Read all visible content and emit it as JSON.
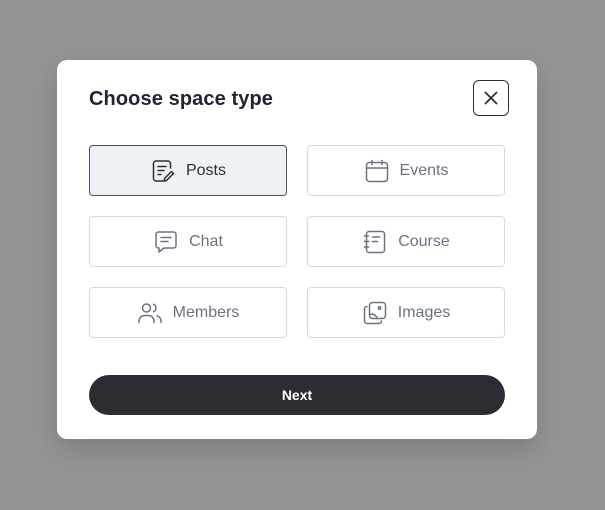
{
  "modal": {
    "title": "Choose space type",
    "close_icon": "close-icon",
    "options": [
      {
        "label": "Posts",
        "icon": "posts-icon",
        "selected": true
      },
      {
        "label": "Events",
        "icon": "calendar-icon",
        "selected": false
      },
      {
        "label": "Chat",
        "icon": "chat-icon",
        "selected": false
      },
      {
        "label": "Course",
        "icon": "course-icon",
        "selected": false
      },
      {
        "label": "Members",
        "icon": "members-icon",
        "selected": false
      },
      {
        "label": "Images",
        "icon": "images-icon",
        "selected": false
      }
    ],
    "next_label": "Next"
  },
  "colors": {
    "overlay": "#959595",
    "modal_bg": "#ffffff",
    "title": "#1f2430",
    "selected_bg": "#eef2f6",
    "selected_border": "#4b5059",
    "option_border": "#d7d9de",
    "option_text": "#6b7280",
    "primary_button": "#2b2d33"
  }
}
